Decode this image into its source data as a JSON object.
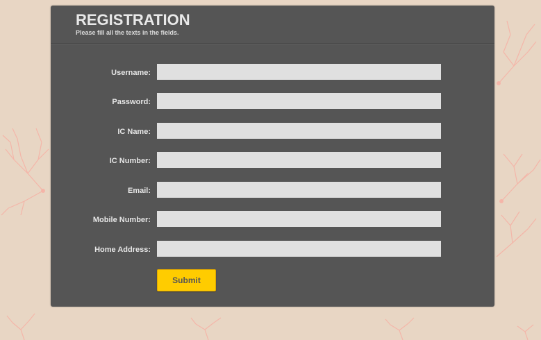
{
  "form": {
    "title": "REGISTRATION",
    "subtitle": "Please fill all the texts in the fields.",
    "fields": [
      {
        "label": "Username:",
        "value": "",
        "placeholder": ""
      },
      {
        "label": "Password:",
        "value": "",
        "placeholder": ""
      },
      {
        "label": "IC Name:",
        "value": "",
        "placeholder": ""
      },
      {
        "label": "IC Number:",
        "value": "",
        "placeholder": ""
      },
      {
        "label": "Email:",
        "value": "",
        "placeholder": ""
      },
      {
        "label": "Mobile Number:",
        "value": "",
        "placeholder": ""
      },
      {
        "label": "Home Address:",
        "value": "",
        "placeholder": ""
      }
    ],
    "submit_label": "Submit"
  },
  "colors": {
    "background": "#e8d6c4",
    "panel": "#555555",
    "input": "#e0e0e0",
    "accent": "#ffcc00",
    "coral": "#f6b0a4"
  },
  "icons": {
    "background_pattern": "coral-branch-icon"
  }
}
